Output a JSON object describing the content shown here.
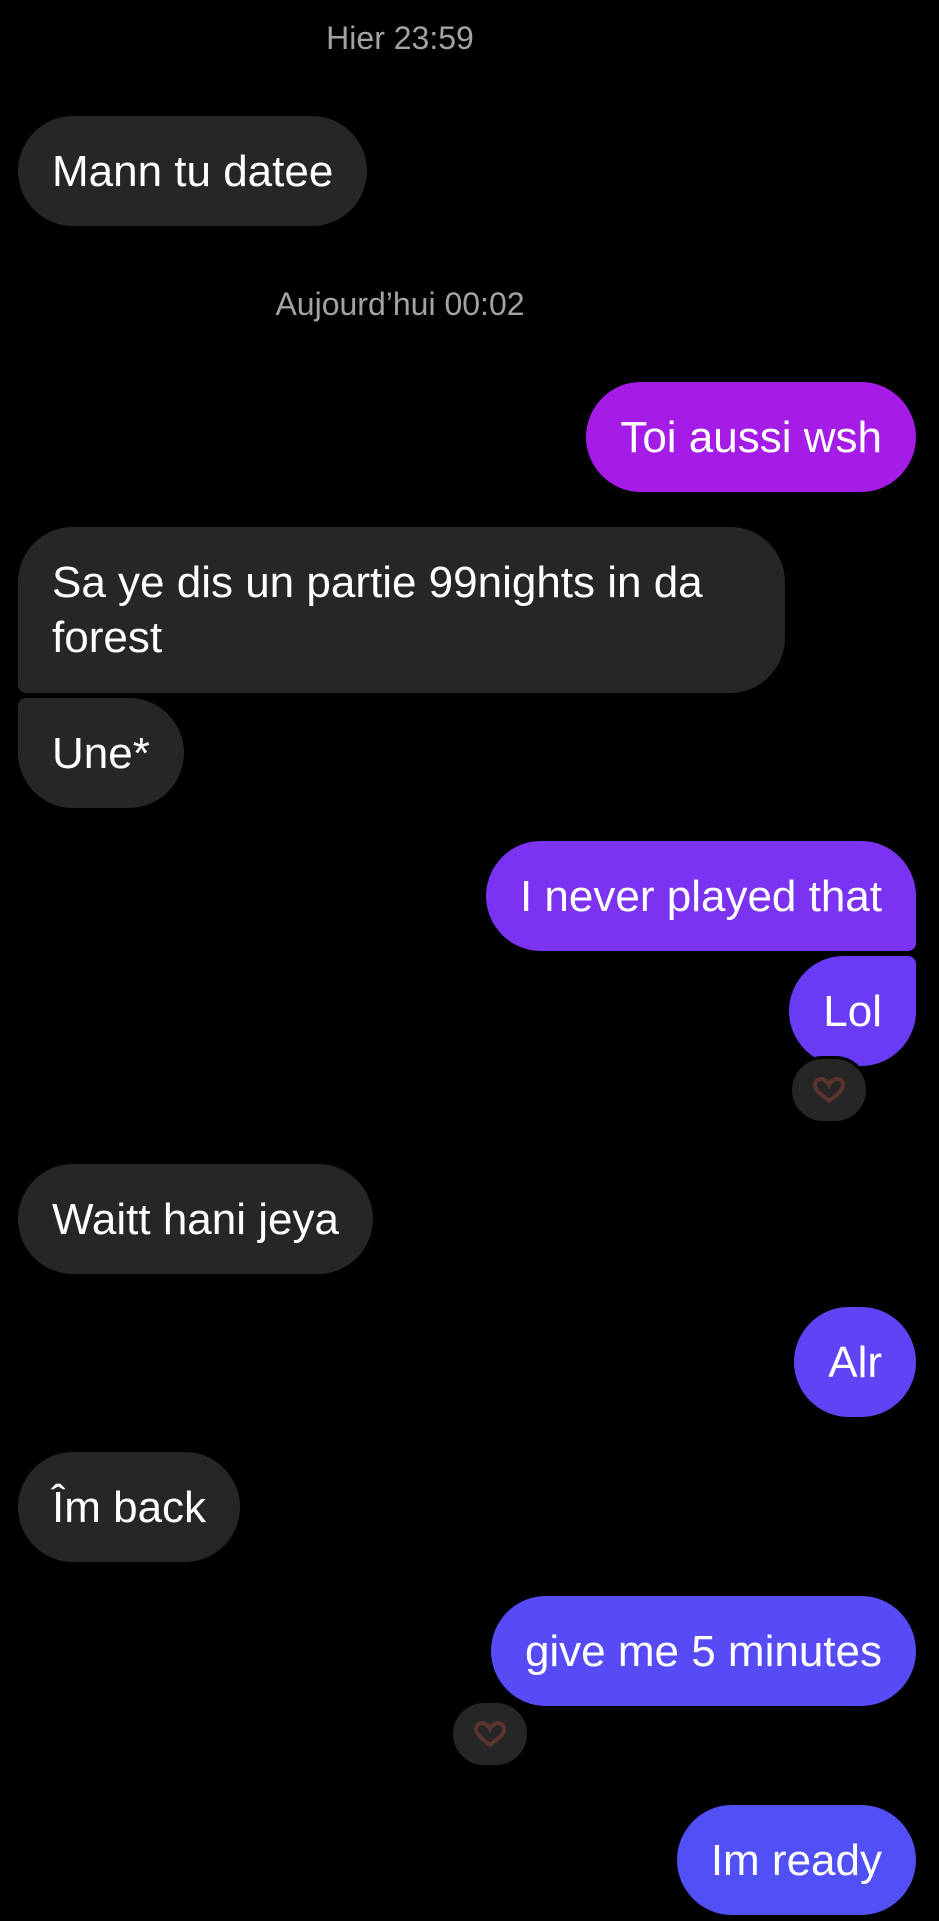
{
  "conversation": {
    "timestamp_1": "Hier 23:59",
    "timestamp_2": "Aujourd’hui 00:02",
    "messages": [
      {
        "text": "Mann tu datee",
        "direction": "incoming"
      },
      {
        "text": "Toi aussi wsh",
        "direction": "outgoing",
        "color": "#a41ce6"
      },
      {
        "text": "Sa ye dis un partie 99nights in da forest",
        "direction": "incoming"
      },
      {
        "text": "Une*",
        "direction": "incoming"
      },
      {
        "text": "I never played that",
        "direction": "outgoing",
        "color": "#7b33f1"
      },
      {
        "text": "Lol",
        "direction": "outgoing",
        "color": "#6a3bf5",
        "reaction": "heart-hands"
      },
      {
        "text": "Waitt hani jeya",
        "direction": "incoming"
      },
      {
        "text": "Alr",
        "direction": "outgoing",
        "color": "#5f44f6"
      },
      {
        "text": "Îm back",
        "direction": "incoming"
      },
      {
        "text": "give me 5 minutes",
        "direction": "outgoing",
        "color": "#574bf6",
        "reaction": "heart-hands"
      },
      {
        "text": "Im ready",
        "direction": "outgoing",
        "color": "#5050f5"
      }
    ]
  },
  "colors": {
    "background": "#000000",
    "incoming_bubble": "#262626",
    "timestamp_text": "#a3a3a3",
    "reaction_icon": "#4a2c2a"
  }
}
